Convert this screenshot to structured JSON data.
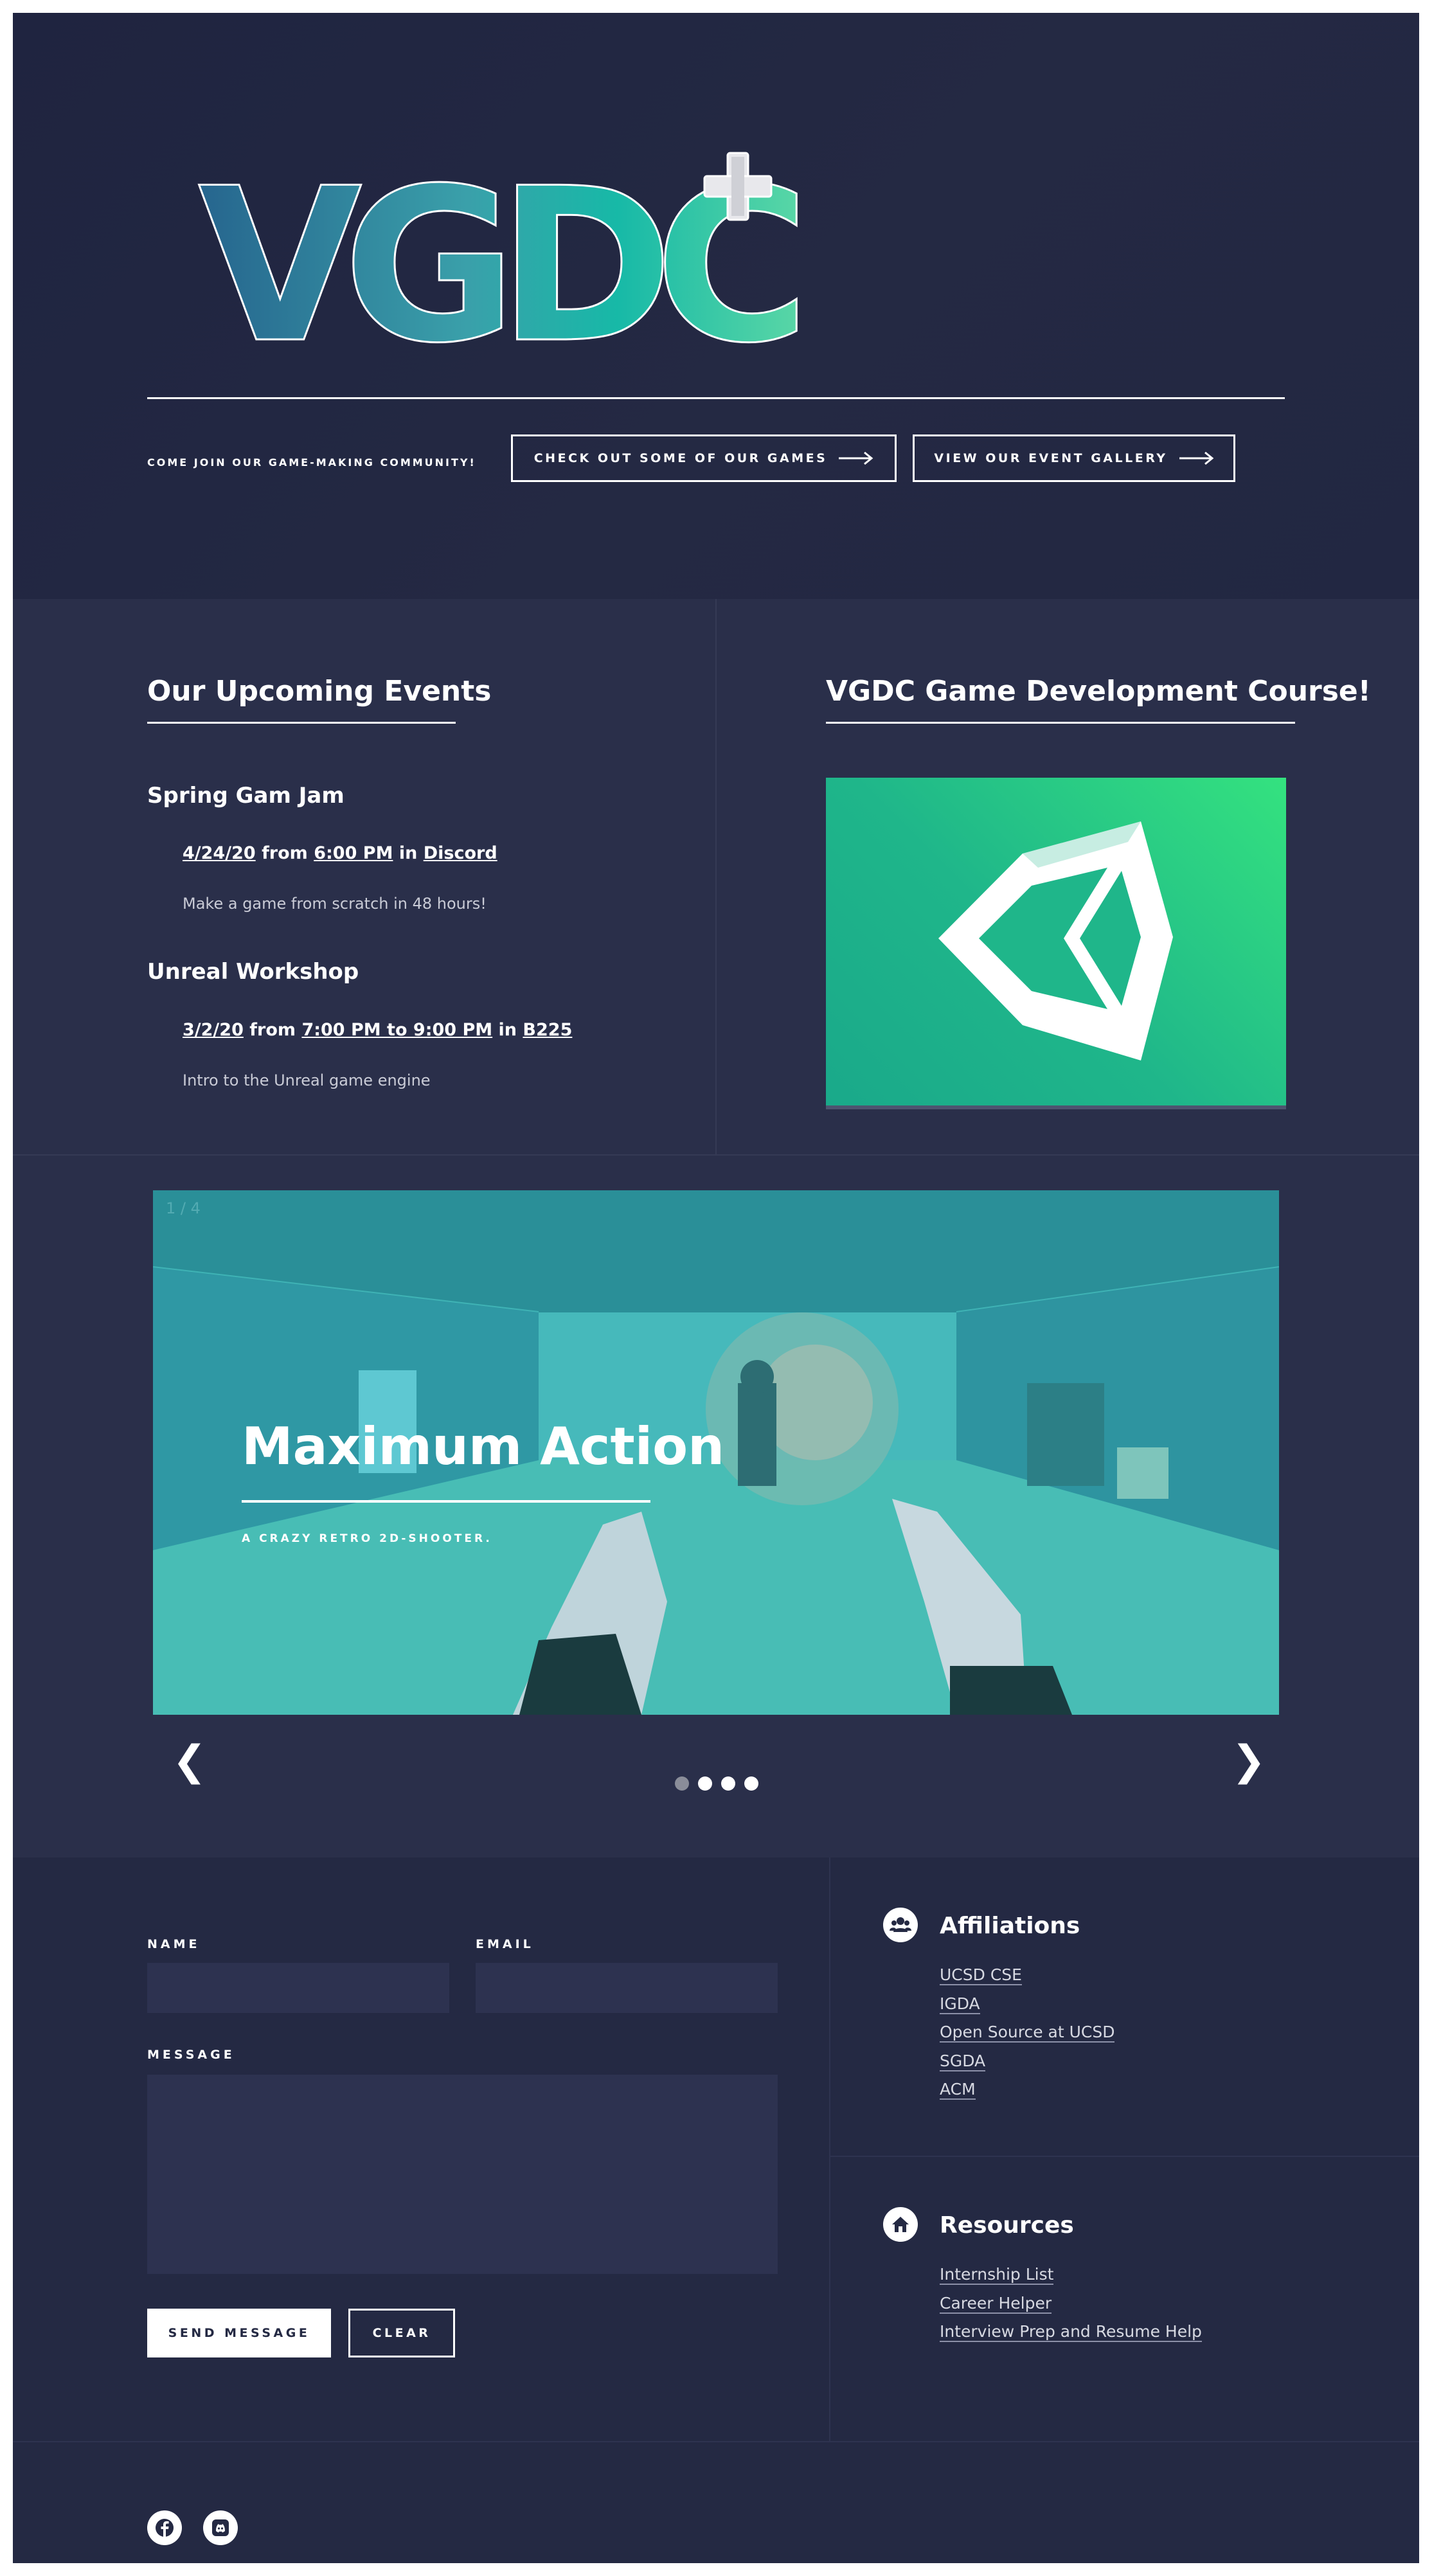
{
  "hero": {
    "logo_text": "VGDC+",
    "tagline": "COME JOIN OUR GAME-MAKING COMMUNITY!",
    "games_button": "CHECK OUT SOME OF OUR GAMES",
    "gallery_button": "VIEW OUR EVENT GALLERY"
  },
  "events": {
    "title": "Our Upcoming Events",
    "items": [
      {
        "name": "Spring Gam Jam",
        "date": "4/24/20",
        "from_word": "from",
        "time": "6:00 PM",
        "in_word": "in",
        "location": "Discord",
        "description": "Make a game from scratch in 48 hours!"
      },
      {
        "name": "Unreal Workshop",
        "date": "3/2/20",
        "from_word": "from",
        "time": "7:00 PM to 9:00 PM",
        "in_word": "in",
        "location": "B225",
        "description": "Intro to the Unreal game engine"
      }
    ]
  },
  "course": {
    "title": "VGDC Game Development Course!",
    "image_icon": "unity-logo-icon"
  },
  "carousel": {
    "counter": "1 / 4",
    "slide_title": "Maximum Action",
    "slide_subtitle": "A CRAZY RETRO 2D-SHOOTER.",
    "prev_label": "❮",
    "next_label": "❯",
    "slide_count": 4,
    "active_index": 0
  },
  "contact": {
    "name_label": "NAME",
    "email_label": "EMAIL",
    "message_label": "MESSAGE",
    "name_value": "",
    "email_value": "",
    "message_value": "",
    "send_label": "SEND MESSAGE",
    "clear_label": "CLEAR"
  },
  "affiliations": {
    "title": "Affiliations",
    "icon": "users-icon",
    "links": [
      "UCSD CSE",
      "IGDA",
      "Open Source at UCSD",
      "SGDA",
      "ACM"
    ]
  },
  "resources": {
    "title": "Resources",
    "icon": "home-icon",
    "links": [
      "Internship List",
      "Career Helper",
      "Interview Prep and Resume Help"
    ]
  },
  "footer": {
    "social_icons": [
      "facebook-icon",
      "discord-icon"
    ]
  },
  "colors": {
    "background": "#242943",
    "section_alt": "#2a2f4a",
    "accent_green": "#34e27f",
    "accent_teal": "#1aa98a",
    "text": "#ffffff"
  }
}
